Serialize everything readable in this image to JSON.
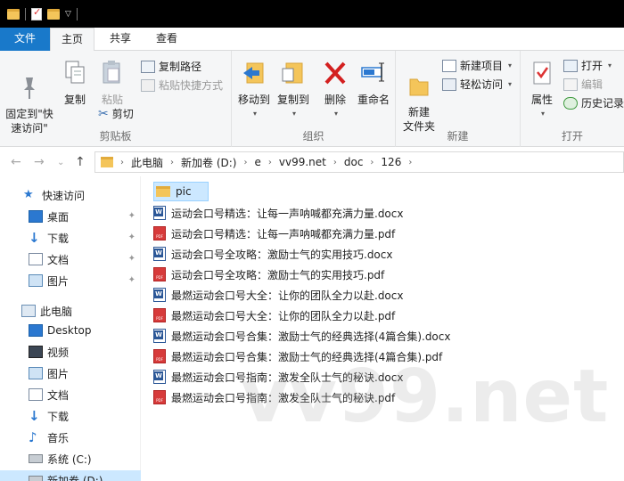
{
  "tabs": {
    "file": "文件",
    "home": "主页",
    "share": "共享",
    "view": "查看"
  },
  "ribbon": {
    "clipboard": {
      "label": "剪贴板",
      "pin_quick": "固定到\"快\n速访问\"",
      "copy": "复制",
      "paste": "粘贴",
      "copy_path": "复制路径",
      "paste_shortcut": "粘贴快捷方式",
      "cut": "剪切"
    },
    "organize": {
      "label": "组织",
      "move_to": "移动到",
      "copy_to": "复制到",
      "delete": "删除",
      "rename": "重命名"
    },
    "new": {
      "label": "新建",
      "new_folder": "新建\n文件夹",
      "new_item": "新建项目",
      "easy_access": "轻松访问"
    },
    "open": {
      "label": "打开",
      "properties": "属性",
      "open": "打开",
      "edit": "编辑",
      "history": "历史记录"
    }
  },
  "address": {
    "crumbs": [
      "此电脑",
      "新加卷 (D:)",
      "e",
      "vv99.net",
      "doc",
      "126"
    ]
  },
  "sidebar": {
    "quick_access": "快速访问",
    "qa_items": [
      "桌面",
      "下载",
      "文档",
      "图片"
    ],
    "this_pc": "此电脑",
    "pc_items": [
      "Desktop",
      "视频",
      "图片",
      "文档",
      "下载",
      "音乐",
      "系统 (C:)",
      "新加卷 (D:)"
    ]
  },
  "files": [
    {
      "name": "pic",
      "type": "folder"
    },
    {
      "name": "运动会口号精选：让每一声呐喊都充满力量.docx",
      "type": "doc"
    },
    {
      "name": "运动会口号精选：让每一声呐喊都充满力量.pdf",
      "type": "pdf"
    },
    {
      "name": "运动会口号全攻略：激励士气的实用技巧.docx",
      "type": "doc"
    },
    {
      "name": "运动会口号全攻略：激励士气的实用技巧.pdf",
      "type": "pdf"
    },
    {
      "name": "最燃运动会口号大全：让你的团队全力以赴.docx",
      "type": "doc"
    },
    {
      "name": "最燃运动会口号大全：让你的团队全力以赴.pdf",
      "type": "pdf"
    },
    {
      "name": "最燃运动会口号合集：激励士气的经典选择(4篇合集).docx",
      "type": "doc"
    },
    {
      "name": "最燃运动会口号合集：激励士气的经典选择(4篇合集).pdf",
      "type": "pdf"
    },
    {
      "name": "最燃运动会口号指南：激发全队士气的秘诀.docx",
      "type": "doc"
    },
    {
      "name": "最燃运动会口号指南：激发全队士气的秘诀.pdf",
      "type": "pdf"
    }
  ],
  "watermark": "vv99.net"
}
